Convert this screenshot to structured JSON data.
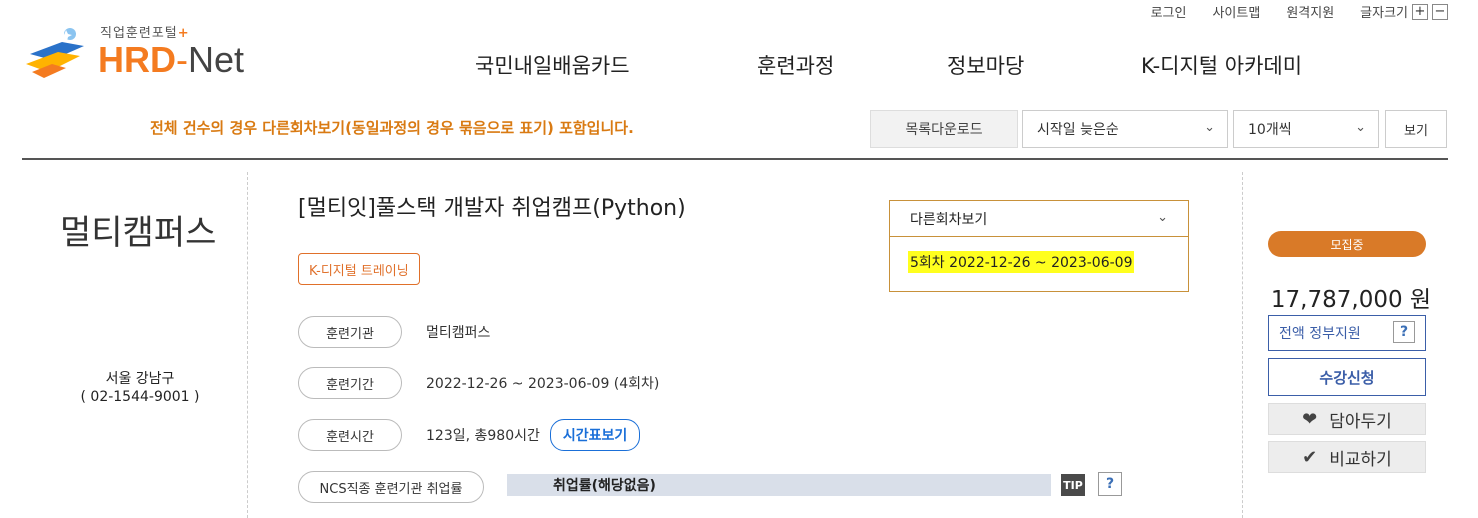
{
  "header": {
    "logo_sub": "직업훈련포털",
    "logo_sub_plus": "+",
    "logo_hrd": "HRD",
    "logo_dash": "-",
    "logo_net": "Net",
    "util_links": [
      "로그인",
      "사이트맵",
      "원격지원",
      "글자크기"
    ],
    "font_plus": "+",
    "font_minus": "−"
  },
  "nav": [
    "국민내일배움카드",
    "훈련과정",
    "정보마당",
    "K-디지털 아카데미"
  ],
  "toolbar": {
    "notice": "전체 건수의 경우 다른회차보기(동일과정의 경우 묶음으로 표기) 포함입니다.",
    "download_label": "목록다운로드",
    "sort_value": "시작일 늦은순",
    "count_value": "10개씩",
    "view_label": "보기"
  },
  "course": {
    "org_name": "멀티캠퍼스",
    "org_address": "서울 강남구",
    "org_phone": "( 02-1544-9001 )",
    "title": "[멀티잇]풀스택 개발자 취업캠프(Python)",
    "tag": "K-디지털 트레이닝",
    "rows": [
      {
        "label": "훈련기관",
        "value": "멀티캠퍼스"
      },
      {
        "label": "훈련기간",
        "value": "2022-12-26 ~ 2023-06-09 (4회차)"
      },
      {
        "label": "훈련시간",
        "value": "123일, 총980시간"
      },
      {
        "label": "NCS직종 훈련기관 취업률",
        "value": "취업률(해당없음)"
      }
    ],
    "timetable_label": "시간표보기",
    "tip_label": "TIP",
    "help_label": "?"
  },
  "other_session": {
    "header": "다른회차보기",
    "item": "5회차 2022-12-26 ~ 2023-06-09"
  },
  "side": {
    "status": "모집중",
    "price": "17,787,000 원",
    "support": "전액 정부지원",
    "apply_label": "수강신청",
    "wish_label": "담아두기",
    "compare_label": "비교하기"
  },
  "colors": {
    "accent_orange": "#f47b20",
    "notice_orange": "#d97a12",
    "link_blue": "#3b5ea8",
    "highlight_yellow": "#ffff1e"
  }
}
